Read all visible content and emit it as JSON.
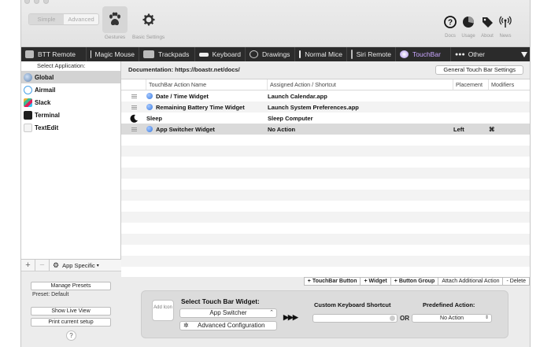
{
  "toolbar": {
    "mode_simple": "Simple",
    "mode_advanced": "Advanced",
    "gestures_label": "Gestures",
    "basic_settings_label": "Basic Settings",
    "docs_label": "Docs",
    "usage_label": "Usage",
    "about_label": "About",
    "news_label": "News"
  },
  "devices": [
    {
      "label": "BTT Remote",
      "icon": "remote-icon"
    },
    {
      "label": "Magic Mouse",
      "icon": "mouse-icon"
    },
    {
      "label": "Trackpads",
      "icon": "trackpad-icon"
    },
    {
      "label": "Keyboard",
      "icon": "keyboard-icon"
    },
    {
      "label": "Drawings",
      "icon": "drawing-icon"
    },
    {
      "label": "Normal Mice",
      "icon": "normal-mouse-icon"
    },
    {
      "label": "Siri Remote",
      "icon": "siri-remote-icon"
    },
    {
      "label": "TouchBar",
      "icon": "touchbar-icon"
    },
    {
      "label": "Other",
      "icon": "other-icon"
    }
  ],
  "sidebar": {
    "header": "Select Application:",
    "apps": [
      {
        "label": "Global",
        "color": "#6d8fb8"
      },
      {
        "label": "Airmail",
        "color": "#4aa3e8"
      },
      {
        "label": "Slack",
        "color": "#e8b33a"
      },
      {
        "label": "Terminal",
        "color": "#1e1e1e"
      },
      {
        "label": "TextEdit",
        "color": "#e9e9e9"
      }
    ],
    "app_specific": "App Specific",
    "manage_presets": "Manage Presets",
    "preset_label": "Preset: Default",
    "show_live_view": "Show Live View",
    "print_setup": "Print current setup",
    "help": "?"
  },
  "main": {
    "documentation": "Documentation: https://boastr.net/docs/",
    "general_settings": "General Touch Bar Settings",
    "columns": {
      "name": "TouchBar Action Name",
      "action": "Assigned Action / Shortcut",
      "placement": "Placement",
      "modifiers": "Modifiers"
    },
    "rows": [
      {
        "name": "Date / Time Widget",
        "action": "Launch Calendar.app",
        "placement": "",
        "modifiers": ""
      },
      {
        "name": "Remaining Battery Time Widget",
        "action": "Launch System Preferences.app",
        "placement": "",
        "modifiers": ""
      },
      {
        "name": "Sleep",
        "action": "Sleep Computer",
        "placement": "",
        "modifiers": ""
      },
      {
        "name": "App Switcher Widget",
        "action": "No Action",
        "placement": "Left",
        "modifiers": "⌘"
      }
    ],
    "actions": {
      "add_touchbar_button": "+ TouchBar Button",
      "add_widget": "+ Widget",
      "add_button_group": "+ Button Group",
      "attach_action": "Attach Additional Action",
      "delete": "- Delete"
    },
    "config": {
      "add_icon": "Add Icon",
      "select_widget_title": "Select Touch Bar Widget:",
      "widget_value": "App Switcher",
      "advanced_config": "Advanced Configuration",
      "arrows": "▶▶▶",
      "custom_shortcut_title": "Custom Keyboard Shortcut",
      "or": "OR",
      "predefined_title": "Predefined Action:",
      "predefined_value": "No Action"
    }
  }
}
